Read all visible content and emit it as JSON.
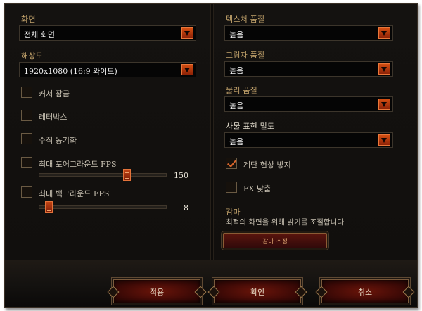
{
  "left": {
    "display_label": "화면",
    "display_value": "전체 화면",
    "resolution_label": "해상도",
    "resolution_value": "1920x1080 (16:9 와이드)",
    "checkboxes": [
      {
        "label": "커서 잠금",
        "checked": false
      },
      {
        "label": "레터박스",
        "checked": false
      },
      {
        "label": "수직 동기화",
        "checked": false
      },
      {
        "label": "최대 포어그라운드 FPS",
        "checked": false
      },
      {
        "label": "최대 백그라운드 FPS",
        "checked": false
      }
    ],
    "sliders": {
      "foreground_fps": {
        "value": "150",
        "fraction": 0.7
      },
      "background_fps": {
        "value": "8",
        "fraction": 0.05
      }
    }
  },
  "right": {
    "texture_quality_label": "텍스처 품질",
    "texture_quality_value": "높음",
    "shadow_quality_label": "그림자 품질",
    "shadow_quality_value": "높음",
    "physics_quality_label": "물리 품질",
    "physics_quality_value": "높음",
    "clutter_density_label": "사물 표현 밀도",
    "clutter_density_value": "높음",
    "checkboxes": [
      {
        "label": "계단 현상 방지",
        "checked": true
      },
      {
        "label": "FX 낮춤",
        "checked": false
      }
    ],
    "gamma_title": "감마",
    "gamma_description": "최적의 화면을 위해 밝기를 조절합니다.",
    "gamma_button": "감마 조정"
  },
  "buttons": {
    "apply": "적용",
    "confirm": "확인",
    "cancel": "취소"
  },
  "colors": {
    "accent_orange": "#d24e12",
    "label_gold": "#c4a46c",
    "background": "#0d0b09"
  },
  "icons": {
    "dropdown_arrow": "triangle-down-icon",
    "checkbox_mark": "checkmark-icon"
  }
}
